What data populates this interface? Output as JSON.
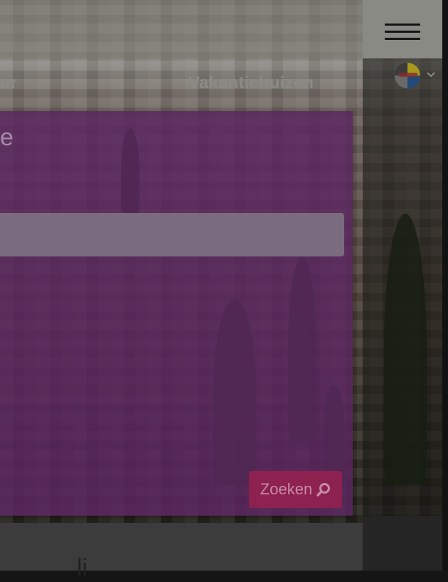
{
  "nav": {
    "item_partial": "ur",
    "vacation_homes": "Vakantiehuizen"
  },
  "hero": {
    "title_partial": "e",
    "search_placeholder": "",
    "search_button": "Zoeken"
  },
  "footer_partial": "li",
  "header": {
    "menu_icon": "hamburger-icon",
    "language_icon": "flag-icon"
  },
  "colors": {
    "overlay_purple": "#5c2660",
    "button": "#8d2150",
    "menu_block": "#8a8a84"
  }
}
